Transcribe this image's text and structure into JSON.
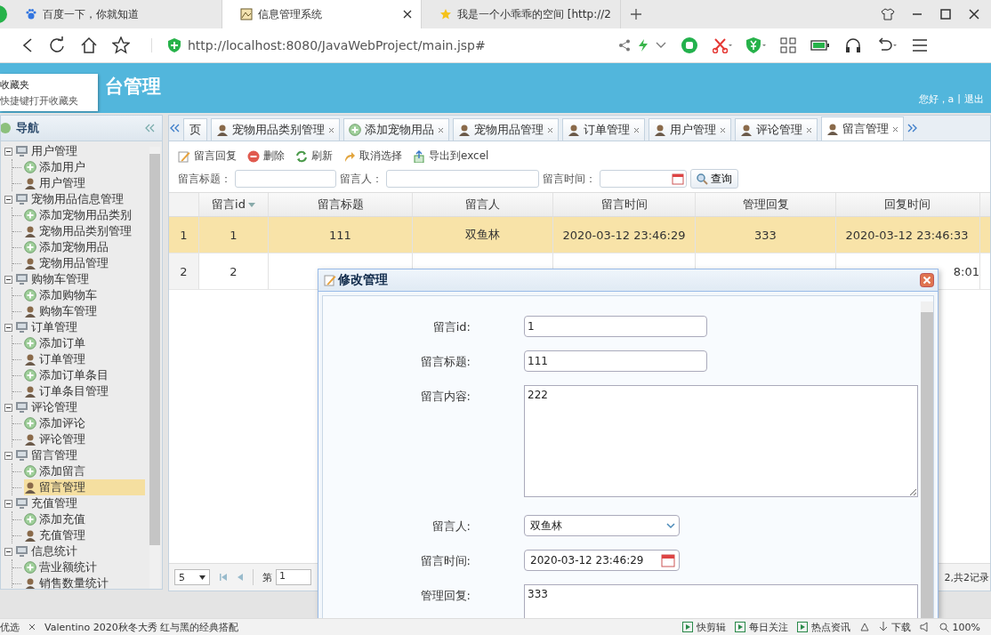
{
  "browser": {
    "tabs": [
      {
        "title": "百度一下，你就知道",
        "kind": "paw",
        "selected": false
      },
      {
        "title": "信息管理系统",
        "kind": "page",
        "selected": true
      },
      {
        "title": "我是一个小乖乖的空间 [http://2",
        "kind": "star",
        "selected": false
      }
    ],
    "url": "http://localhost:8080/JavaWebProject/main.jsp#"
  },
  "bookmarks_popup": {
    "title": "收藏夹",
    "hint": "快捷键打开收藏夹"
  },
  "header": {
    "title": "台管理",
    "greeting": "您好，a",
    "separator": "|",
    "logout": "退出"
  },
  "nav": {
    "title": "导航",
    "tree": [
      {
        "label": "用户管理",
        "expanded": true,
        "children": [
          {
            "label": "添加用户",
            "kind": "add",
            "selected": false
          },
          {
            "label": "用户管理",
            "kind": "manage",
            "selected": false
          }
        ]
      },
      {
        "label": "宠物用品信息管理",
        "expanded": true,
        "children": [
          {
            "label": "添加宠物用品类别",
            "kind": "add",
            "selected": false
          },
          {
            "label": "宠物用品类别管理",
            "kind": "manage",
            "selected": false
          },
          {
            "label": "添加宠物用品",
            "kind": "add",
            "selected": false
          },
          {
            "label": "宠物用品管理",
            "kind": "manage",
            "selected": false
          }
        ]
      },
      {
        "label": "购物车管理",
        "expanded": true,
        "children": [
          {
            "label": "添加购物车",
            "kind": "add",
            "selected": false
          },
          {
            "label": "购物车管理",
            "kind": "manage",
            "selected": false
          }
        ]
      },
      {
        "label": "订单管理",
        "expanded": true,
        "children": [
          {
            "label": "添加订单",
            "kind": "add",
            "selected": false
          },
          {
            "label": "订单管理",
            "kind": "manage",
            "selected": false
          },
          {
            "label": "添加订单条目",
            "kind": "add",
            "selected": false
          },
          {
            "label": "订单条目管理",
            "kind": "manage",
            "selected": false
          }
        ]
      },
      {
        "label": "评论管理",
        "expanded": true,
        "children": [
          {
            "label": "添加评论",
            "kind": "add",
            "selected": false
          },
          {
            "label": "评论管理",
            "kind": "manage",
            "selected": false
          }
        ]
      },
      {
        "label": "留言管理",
        "expanded": true,
        "children": [
          {
            "label": "添加留言",
            "kind": "add",
            "selected": false
          },
          {
            "label": "留言管理",
            "kind": "manage",
            "selected": true
          }
        ]
      },
      {
        "label": "充值管理",
        "expanded": true,
        "children": [
          {
            "label": "添加充值",
            "kind": "add",
            "selected": false
          },
          {
            "label": "充值管理",
            "kind": "manage",
            "selected": false
          }
        ]
      },
      {
        "label": "信息统计",
        "expanded": true,
        "children": [
          {
            "label": "营业额统计",
            "kind": "add",
            "selected": false
          },
          {
            "label": "销售数量统计",
            "kind": "manage",
            "selected": false
          }
        ]
      }
    ]
  },
  "tabs": [
    {
      "label": "页",
      "kind": "plain",
      "selected": false
    },
    {
      "label": "宠物用品类别管理",
      "kind": "manage",
      "selected": false
    },
    {
      "label": "添加宠物用品",
      "kind": "add",
      "selected": false
    },
    {
      "label": "宠物用品管理",
      "kind": "manage",
      "selected": false
    },
    {
      "label": "订单管理",
      "kind": "manage",
      "selected": false
    },
    {
      "label": "用户管理",
      "kind": "manage",
      "selected": false
    },
    {
      "label": "评论管理",
      "kind": "manage",
      "selected": false
    },
    {
      "label": "留言管理",
      "kind": "manage",
      "selected": true
    }
  ],
  "toolbar": [
    {
      "label": "留言回复",
      "kind": "edit"
    },
    {
      "label": "删除",
      "kind": "delete"
    },
    {
      "label": "刷新",
      "kind": "refresh"
    },
    {
      "label": "取消选择",
      "kind": "undo"
    },
    {
      "label": "导出到excel",
      "kind": "export"
    }
  ],
  "search": {
    "fields": [
      {
        "label": "留言标题：",
        "kind": "text"
      },
      {
        "label": "留言人：",
        "kind": "text"
      },
      {
        "label": "留言时间：",
        "kind": "date"
      }
    ],
    "button": "查询"
  },
  "table": {
    "columns": [
      "留言id",
      "留言标题",
      "留言人",
      "留言时间",
      "管理回复",
      "回复时间"
    ],
    "rows": [
      {
        "index": "1",
        "selected": true,
        "cells": [
          "1",
          "111",
          "双鱼林",
          "2020-03-12 23:46:29",
          "333",
          "2020-03-12 23:46:33"
        ]
      },
      {
        "index": "2",
        "selected": false,
        "cells": [
          "2",
          null,
          null,
          null,
          null,
          "8:01"
        ]
      }
    ]
  },
  "pagination": {
    "page_size": "5",
    "page_label": "第",
    "page": "1",
    "summary": "2,共2记录"
  },
  "dialog": {
    "title": "修改管理",
    "fields": [
      {
        "label": "留言id:",
        "kind": "text",
        "value": "1"
      },
      {
        "label": "留言标题:",
        "kind": "text",
        "value": "111"
      },
      {
        "label": "留言内容:",
        "kind": "textarea",
        "value": "222"
      },
      {
        "label": "留言人:",
        "kind": "select",
        "value": "双鱼林"
      },
      {
        "label": "留言时间:",
        "kind": "date",
        "value": "2020-03-12 23:46:29"
      },
      {
        "label": "管理回复:",
        "kind": "textarea",
        "value": "333"
      }
    ]
  },
  "status_bar": {
    "left": [
      "优选",
      "Valentino 2020秋冬大秀 红与黑的经典搭配"
    ],
    "items": [
      "快剪辑",
      "每日关注",
      "热点资讯"
    ],
    "download": "下载",
    "zoom": "100%"
  }
}
